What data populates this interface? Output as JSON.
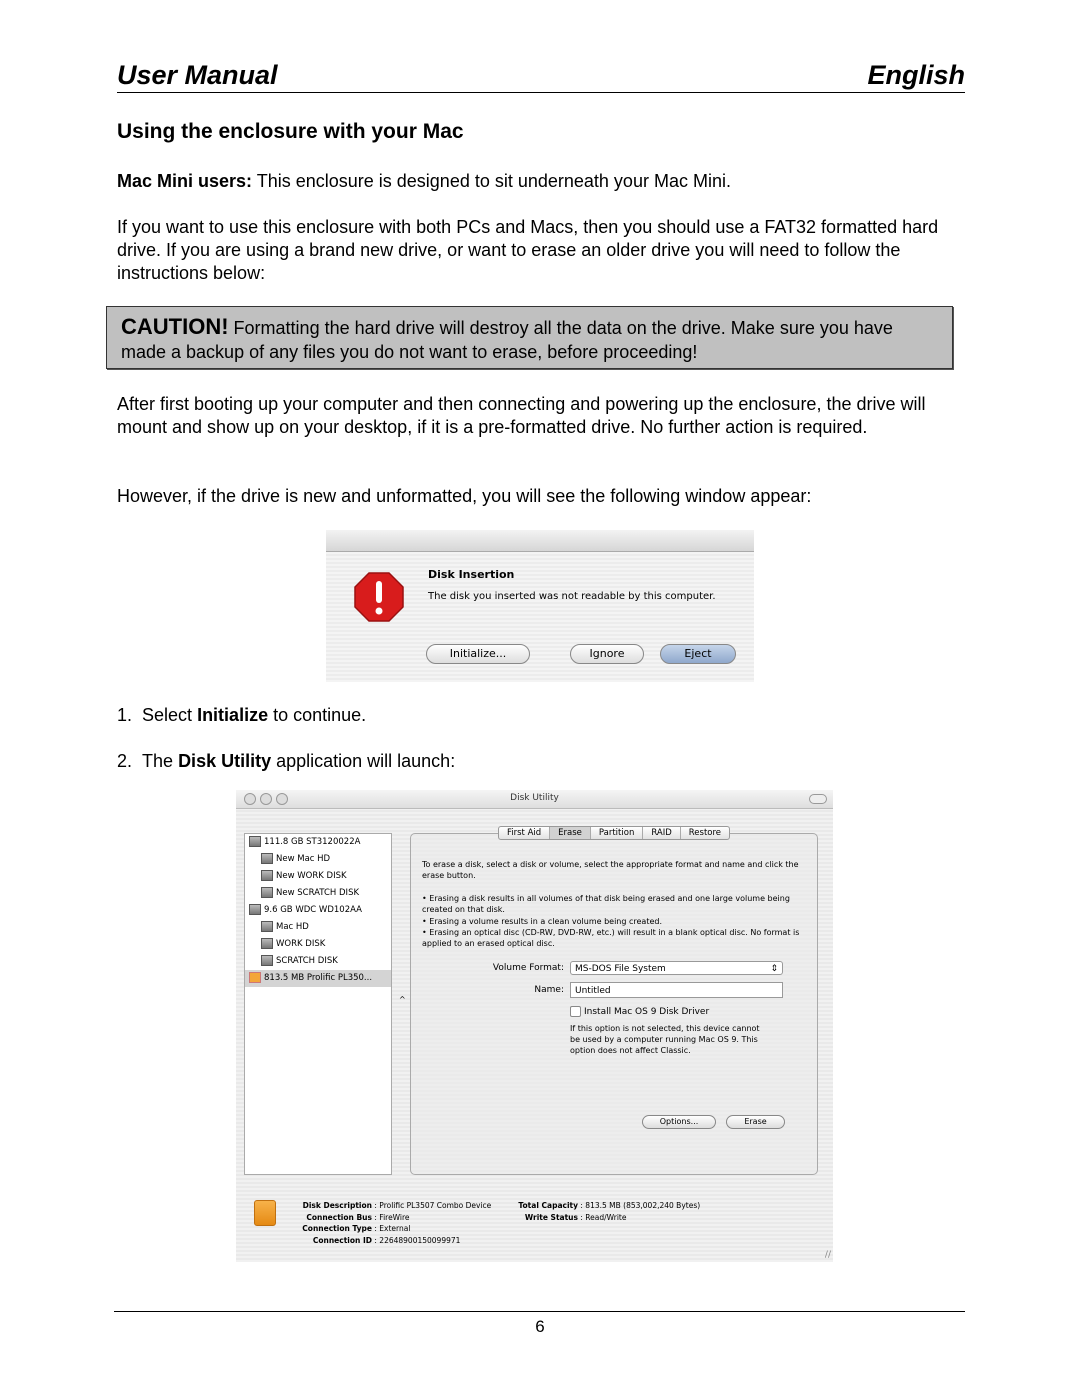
{
  "header": {
    "left": "User Manual",
    "right": "English"
  },
  "section_title": "Using the enclosure with your Mac",
  "para1": {
    "bold": "Mac Mini users:",
    "text": " This enclosure is designed to sit underneath your Mac Mini."
  },
  "para2": "If you want to use this enclosure with both PCs and Macs, then you should use a FAT32 formatted hard drive. If you are using a brand new drive, or want to erase an older drive you will need to follow the instructions below:",
  "caution": {
    "bold": "CAUTION!",
    "text": " Formatting the hard drive will destroy all the data on the drive. Make sure you have made a backup of any files you do not want to erase, before proceeding!"
  },
  "para3": "After first booting up your computer and then connecting and powering up the enclosure, the drive will mount and show up on your desktop, if it is a pre-formatted drive. No further action is required.",
  "para4": "However, if the drive is new and unformatted, you will see the following window appear:",
  "dialog": {
    "icon": "stop-icon",
    "title": "Disk Insertion",
    "message": "The disk you inserted was not readable by this computer.",
    "buttons": {
      "initialize": "Initialize...",
      "ignore": "Ignore",
      "eject": "Eject"
    }
  },
  "steps": [
    {
      "num": "1.",
      "pre": "Select ",
      "bold": "Initialize",
      "post": " to continue."
    },
    {
      "num": "2.",
      "pre": "The ",
      "bold": "Disk Utility",
      "post": " application will launch:"
    }
  ],
  "disk_utility": {
    "title": "Disk Utility",
    "disks": [
      {
        "label": "111.8 GB ST3120022A",
        "sub": false
      },
      {
        "label": "New Mac HD",
        "sub": true
      },
      {
        "label": "New WORK DISK",
        "sub": true
      },
      {
        "label": "New SCRATCH DISK",
        "sub": true
      },
      {
        "label": "9.6 GB WDC WD102AA",
        "sub": false
      },
      {
        "label": "Mac HD",
        "sub": true
      },
      {
        "label": "WORK DISK",
        "sub": true
      },
      {
        "label": "SCRATCH DISK",
        "sub": true
      },
      {
        "label": "813.5 MB Prolific PL350...",
        "sub": false,
        "selected": true
      }
    ],
    "tabs": [
      "First Aid",
      "Erase",
      "Partition",
      "RAID",
      "Restore"
    ],
    "active_tab": "Erase",
    "intro": "To erase a disk, select a disk or volume, select the appropriate format and name and click the erase button.",
    "bullets": [
      "• Erasing a disk results in all volumes of that disk being erased and one large volume being created on that disk.",
      "• Erasing a volume results in a clean volume being created.",
      "• Erasing an optical disc (CD-RW, DVD-RW, etc.) will result in a blank optical disc.  No format is applied to an erased optical disc."
    ],
    "volume_format_label": "Volume Format:",
    "volume_format_value": "MS-DOS File System",
    "name_label": "Name:",
    "name_value": "Untitled",
    "checkbox_label": "Install Mac OS 9 Disk Driver",
    "checkbox_checked": false,
    "checkbox_note": "If this option is not selected, this device cannot be used by a computer running Mac OS 9.  This option does not affect Classic.",
    "options_button": "Options...",
    "erase_button": "Erase",
    "info": {
      "disk_description_label": "Disk Description",
      "disk_description": "Prolific PL3507 Combo Device",
      "connection_bus_label": "Connection Bus",
      "connection_bus": "FireWire",
      "connection_type_label": "Connection Type",
      "connection_type": "External",
      "connection_id_label": "Connection ID",
      "connection_id": "22648900150099971",
      "total_capacity_label": "Total Capacity",
      "total_capacity": "813.5 MB (853,002,240 Bytes)",
      "write_status_label": "Write Status",
      "write_status": "Read/Write"
    }
  },
  "page_number": "6"
}
